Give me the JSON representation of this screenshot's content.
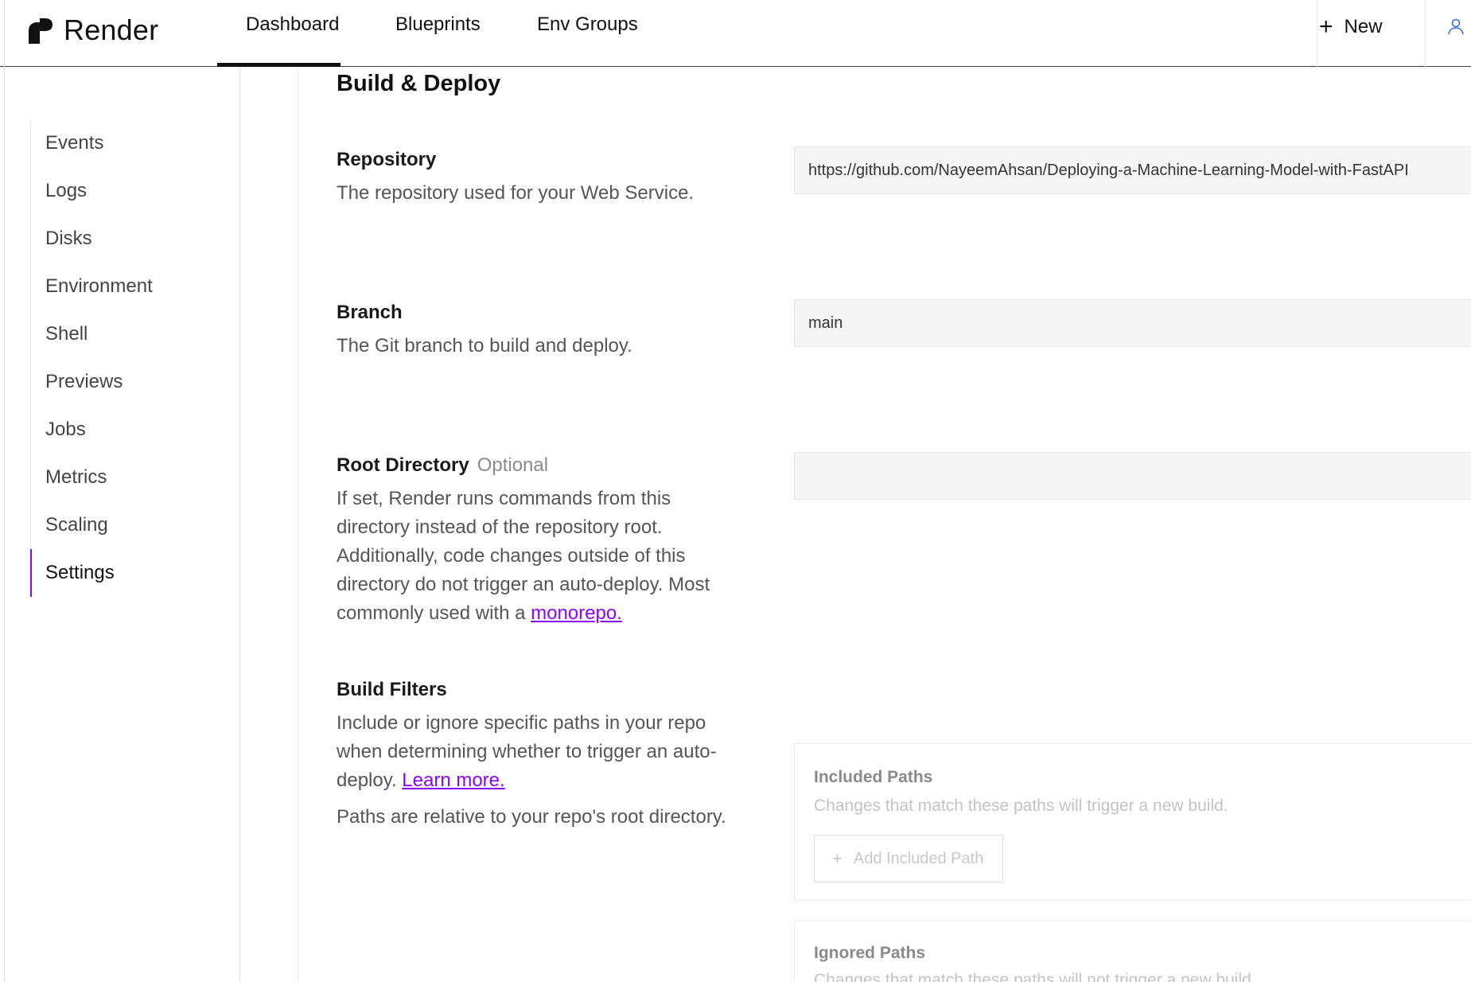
{
  "app": {
    "name": "Render"
  },
  "nav": {
    "tabs": [
      "Dashboard",
      "Blueprints",
      "Env Groups"
    ],
    "active_tab": "Dashboard",
    "new_label": "New"
  },
  "sidebar": {
    "items": [
      "Events",
      "Logs",
      "Disks",
      "Environment",
      "Shell",
      "Previews",
      "Jobs",
      "Metrics",
      "Scaling",
      "Settings"
    ],
    "active": "Settings"
  },
  "section": {
    "title": "Build & Deploy",
    "repository": {
      "label": "Repository",
      "description": "The repository used for your Web Service.",
      "value": "https://github.com/NayeemAhsan/Deploying-a-Machine-Learning-Model-with-FastAPI"
    },
    "branch": {
      "label": "Branch",
      "description": "The Git branch to build and deploy.",
      "value": "main"
    },
    "root_directory": {
      "label": "Root Directory",
      "optional": "Optional",
      "description": "If set, Render runs commands from this directory instead of the repository root. Additionally, code changes outside of this directory do not trigger an auto-deploy. Most commonly used with a",
      "link": "monorepo.",
      "value": ""
    },
    "build_filters": {
      "label": "Build Filters",
      "description": "Include or ignore specific paths in your repo when determining whether to trigger an auto-deploy.",
      "link": "Learn more.",
      "note": "Paths are relative to your repo's root directory.",
      "included": {
        "title": "Included Paths",
        "description": "Changes that match these paths will trigger a new build.",
        "button": "Add Included Path"
      },
      "ignored": {
        "title": "Ignored Paths",
        "description": "Changes that match these paths will not trigger a new build."
      }
    }
  },
  "colors": {
    "accent": "#8a05ff"
  }
}
